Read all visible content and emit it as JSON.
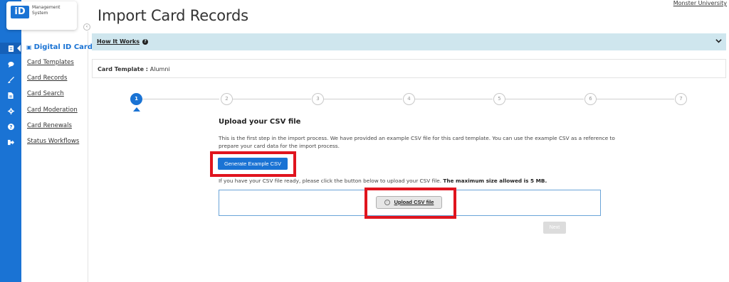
{
  "app": {
    "logo_mark": "iD",
    "logo_text_line1": "Management",
    "logo_text_line2": "System",
    "org_name": "Monster University"
  },
  "rail": {
    "icons": [
      "id-card-icon",
      "chat-icon",
      "brush-icon",
      "document-icon",
      "gear-icon",
      "help-icon",
      "logout-icon"
    ]
  },
  "sidebar": {
    "section_title": "Digital ID Cards",
    "items": [
      {
        "label": "Card Templates"
      },
      {
        "label": "Card Records"
      },
      {
        "label": "Card Search"
      },
      {
        "label": "Card Moderation"
      },
      {
        "label": "Card Renewals"
      },
      {
        "label": "Status Workflows"
      }
    ]
  },
  "header": {
    "title": "Import Card Records"
  },
  "how_it_works": {
    "label": "How It Works"
  },
  "template": {
    "label": "Card Template :",
    "value": "Alumni"
  },
  "stepper": {
    "steps": [
      "1",
      "2",
      "3",
      "4",
      "5",
      "6",
      "7"
    ],
    "active_index": 0
  },
  "main": {
    "title": "Upload your CSV file",
    "description": "This is the first step in the import process. We have provided an example CSV file for this card template. You can use the example CSV as a reference to prepare your card data for the import process.",
    "generate_button": "Generate Example CSV",
    "upload_hint": "If you have your CSV file ready, please click the button below to upload your CSV file.",
    "upload_hint_bold": "The maximum size allowed is 5 MB.",
    "upload_button": "Upload CSV file",
    "next_button": "Next"
  },
  "colors": {
    "brand_blue": "#1a73d4",
    "how_bar_bg": "#cfe6ee",
    "highlight_red": "#e0141e"
  }
}
